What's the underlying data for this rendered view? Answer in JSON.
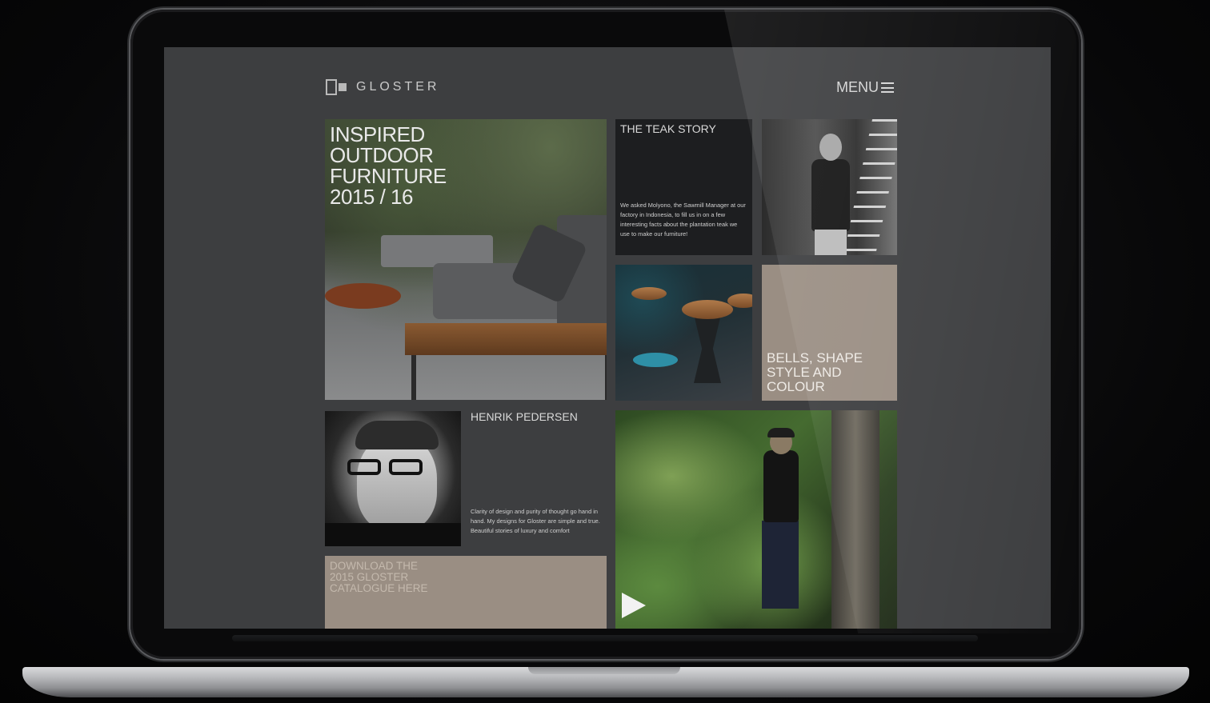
{
  "site": {
    "logo_text": "GLOSTER",
    "menu_label": "MENU"
  },
  "tiles": {
    "hero": {
      "title": "INSPIRED\nOUTDOOR\nFURNITURE\n2015 / 16"
    },
    "teak": {
      "title": "THE TEAK STORY",
      "body": "We asked Molyono, the Sawmill Manager at our factory in Indonesia, to fill us in on a few interesting facts about the plantation teak we use to make our furniture!"
    },
    "bells": {
      "title": "BELLS, SHAPE\nSTYLE AND\nCOLOUR"
    },
    "henrik": {
      "title": "HENRIK PEDERSEN",
      "body": "Clarity of design and purity of thought go hand in hand. My designs for Gloster are simple and true. Beautiful stories of luxury and comfort"
    },
    "download": {
      "title": "DOWNLOAD THE\n2015 GLOSTER\nCATALOGUE HERE"
    }
  },
  "icons": {
    "menu": "hamburger-icon",
    "logo": "gloster-logo-icon",
    "video": "play-icon"
  },
  "colors": {
    "screen_bg": "#3d3e40",
    "accent_tile": "#9a8e83",
    "dark_tile": "#1d1e20"
  }
}
